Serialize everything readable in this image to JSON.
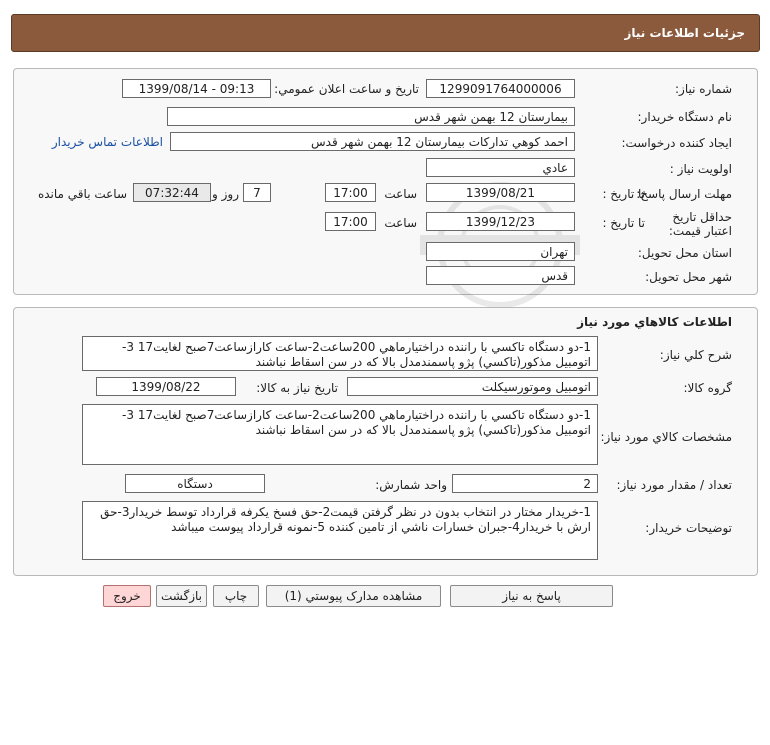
{
  "header": {
    "title": "جزئيات اطلاعات نياز"
  },
  "info": {
    "need_number_label": "شماره نياز:",
    "need_number": "1299091764000006",
    "announce_label": "تاريخ و ساعت اعلان عمومي:",
    "announce_value": "1399/08/14 - 09:13",
    "buyer_org_label": "نام دستگاه خريدار:",
    "buyer_org": "بيمارستان 12 بهمن شهر قدس",
    "creator_label": "ايجاد کننده درخواست:",
    "creator": "احمد کوهي تدارکات بيمارستان 12 بهمن شهر قدس",
    "contact_link": "اطلاعات تماس خريدار",
    "priority_label": "اولويت نياز :",
    "priority": "عادي",
    "deadline_label": "مهلت ارسال پاسخ:",
    "until_date_label": "تا تاريخ :",
    "deadline_date": "1399/08/21",
    "time_label": "ساعت",
    "deadline_time": "17:00",
    "days_value": "7",
    "days_label": "روز و",
    "remaining_time": "07:32:44",
    "remaining_label": "ساعت باقي مانده",
    "validity_label": "حداقل تاريخ اعتبار قيمت:",
    "validity_until_label": "تا تاريخ :",
    "validity_date": "1399/12/23",
    "validity_time_label": "ساعت",
    "validity_time": "17:00",
    "province_label": "استان محل تحويل:",
    "province": "تهران",
    "city_label": "شهر محل تحويل:",
    "city": "قدس"
  },
  "goods": {
    "section_title": "اطلاعات کالاهاي مورد نياز",
    "summary_label": "شرح کلي نياز:",
    "summary": "1-دو دستگاه تاکسي با راننده دراختيارماهي 200ساعت2-ساعت کارازساعت7صبح لغايت17  3-اتومبيل مذکور(تاکسي) پژو پاسمندمدل بالا که در سن اسقاط نباشند",
    "group_label": "گروه کالا:",
    "group": "اتومبيل وموتورسيکلت",
    "need_date_label": "تاريخ نياز به کالا:",
    "need_date": "1399/08/22",
    "specs_label": "مشخصات کالاي مورد نياز:",
    "specs": "1-دو دستگاه تاکسي با راننده دراختيارماهي 200ساعت2-ساعت کارازساعت7صبح لغايت17  3-اتومبيل مذکور(تاکسي) پژو پاسمندمدل بالا که در سن اسقاط نباشند",
    "qty_label": "تعداد / مقدار مورد نياز:",
    "qty": "2",
    "unit_label": "واحد شمارش:",
    "unit": "دستگاه",
    "buyer_notes_label": "توضيحات خريدار:",
    "buyer_notes": "1-خريدار مختار در انتخاب بدون در نظر گرفتن قيمت2-حق فسخ يکرفه قرارداد توسط خريدار3-حق ارش با خريدار4-جبران خسارات ناشي از تامين کننده 5-نمونه قرارداد پيوست ميباشد"
  },
  "actions": {
    "reply": "پاسخ به نياز",
    "attachments": "مشاهده مدارک پيوستي (1)",
    "print": "چاپ",
    "back": "بازگشت",
    "exit": "خروج"
  },
  "colors": {
    "header_bg": "#8b5a3c",
    "link": "#1a4fa3",
    "exit_button_bg": "#ffd6d6"
  }
}
